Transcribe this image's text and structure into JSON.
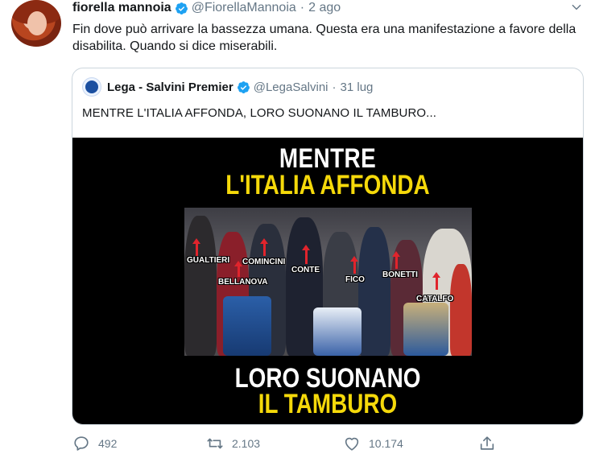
{
  "tweet": {
    "display_name": "fiorella mannoia",
    "handle": "@FiorellaMannoia",
    "separator": "·",
    "time": "2 ago",
    "text": "Fin dove può arrivare la bassezza umana. Questa era una manifestazione a favore della disabilita. Quando si dice miserabili."
  },
  "quoted": {
    "display_name": "Lega - Salvini Premier",
    "handle": "@LegaSalvini",
    "separator": "·",
    "time": "31 lug",
    "text": "MENTRE L'ITALIA AFFONDA, LORO SUONANO IL TAMBURO...",
    "media": {
      "title_line1": "MENTRE",
      "title_line2": "L'ITALIA AFFONDA",
      "bottom_line1": "LORO SUONANO",
      "bottom_line2": "IL TAMBURO",
      "labels": [
        "GUALTIERI",
        "COMINCINI",
        "BELLANOVA",
        "CONTE",
        "FICO",
        "BONETTI",
        "CATALFO"
      ]
    }
  },
  "actions": {
    "replies": "492",
    "retweets": "2.103",
    "likes": "10.174"
  },
  "colors": {
    "verified": "#1da1f2",
    "muted": "#657786",
    "yellow_title": "#f5d90a",
    "arrow_red": "#e0242c"
  }
}
